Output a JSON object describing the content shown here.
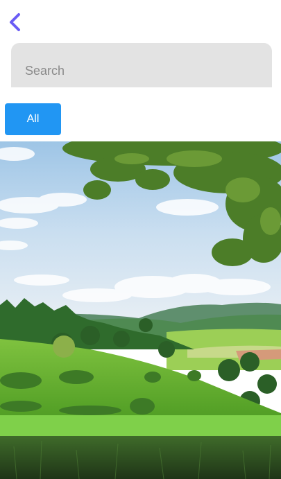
{
  "header": {
    "back_icon": "chevron-left-icon",
    "accent_color": "#6a5cf5"
  },
  "search": {
    "placeholder": "Search",
    "value": ""
  },
  "filters": {
    "chips": [
      {
        "label": "All",
        "selected": true
      }
    ],
    "selected_color": "#2196f3"
  },
  "gallery": {
    "image_subject": "green-hills-landscape"
  }
}
